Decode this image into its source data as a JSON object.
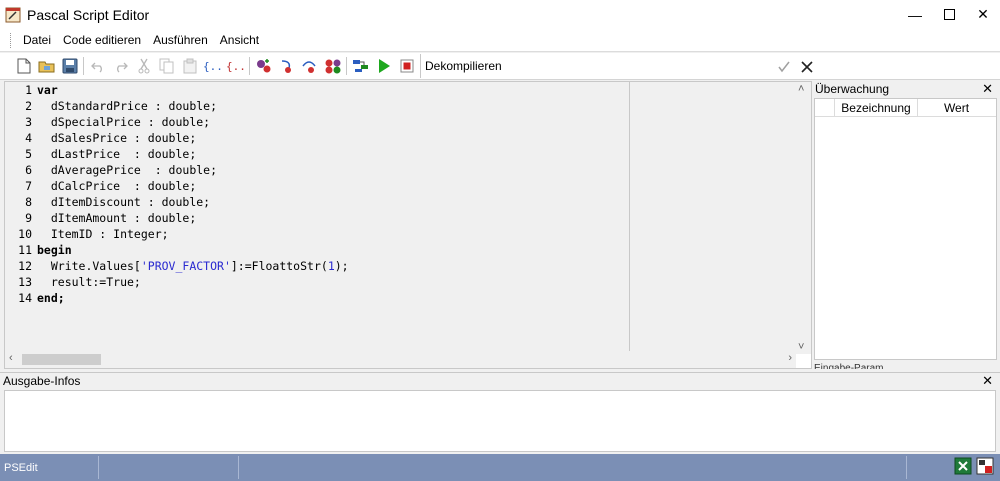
{
  "window": {
    "title": "Pascal Script Editor"
  },
  "menu": [
    "Datei",
    "Code editieren",
    "Ausführen",
    "Ansicht"
  ],
  "toolbar": {
    "decompile_label": "Dekompilieren"
  },
  "editor": {
    "line_numbers": [
      "1",
      "2",
      "3",
      "4",
      "5",
      "6",
      "7",
      "8",
      "9",
      "10",
      "11",
      "12",
      "13",
      "14"
    ],
    "lines": [
      "var",
      "  dStandardPrice : double;",
      "  dSpecialPrice : double;",
      "  dSalesPrice : double;",
      "  dLastPrice  : double;",
      "  dAveragePrice  : double;",
      "  dCalcPrice  : double;",
      "  dItemDiscount : double;",
      "  dItemAmount : double;",
      "  ItemID : Integer;",
      "begin",
      "  Write.Values['PROV_FACTOR']:=FloattoStr(1);",
      "  result:=True;",
      "end;"
    ]
  },
  "watch_panel": {
    "title": "Überwachung",
    "columns": [
      "Bezeichnung",
      "Wert"
    ],
    "sub_tab_label": "Eingabe-Param"
  },
  "output_panel": {
    "title": "Ausgabe-Infos"
  },
  "statusbar": {
    "cells": [
      "PSEdit",
      "",
      ""
    ]
  },
  "colors": {
    "status_bg": "#7b8fb5",
    "string_color": "#2a2ad0",
    "run_green": "#1ea81e",
    "stop_red": "#d02020"
  }
}
